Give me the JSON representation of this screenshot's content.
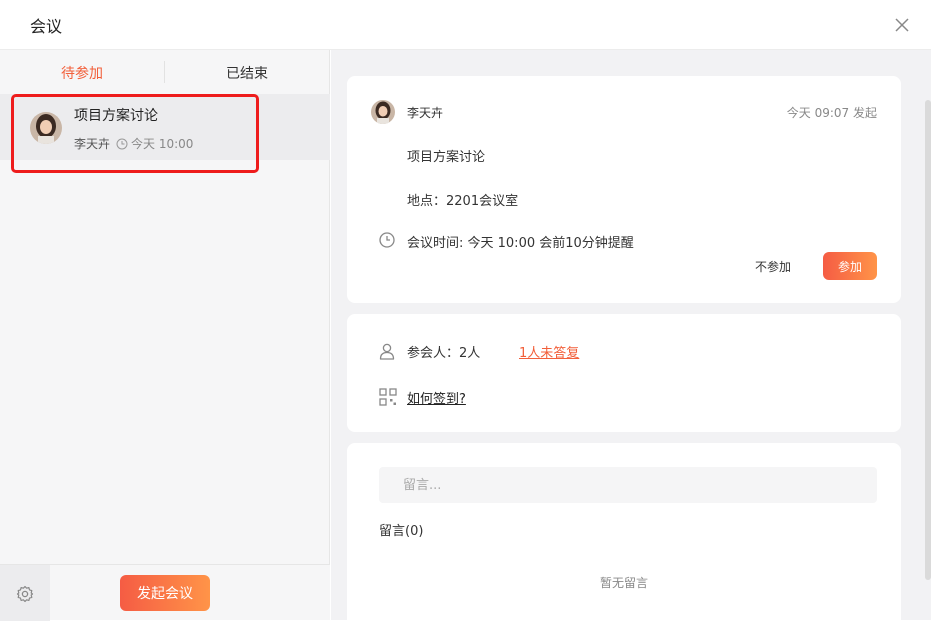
{
  "window": {
    "title": "会议"
  },
  "tabs": {
    "pending": "待参加",
    "ended": "已结束"
  },
  "meeting_list": [
    {
      "title": "项目方案讨论",
      "organizer": "李天卉",
      "time": "今天 10:00"
    }
  ],
  "footer": {
    "start_meeting": "发起会议"
  },
  "detail": {
    "organizer": "李天卉",
    "initiated": "今天 09:07 发起",
    "subject": "项目方案讨论",
    "location": "地点：2201会议室",
    "schedule": "会议时间: 今天 10:00 会前10分钟提醒",
    "decline": "不参加",
    "join": "参加"
  },
  "attendance": {
    "attendees": "参会人：2人",
    "unsigned": "1人未答复",
    "how_to_sign": "如何签到?"
  },
  "comments": {
    "placeholder": "留言...",
    "count_label": "留言(0)",
    "empty": "暂无留言"
  },
  "colors": {
    "accent": "#f25f3a",
    "gradient_start": "#f55c44",
    "gradient_end": "#ff9448",
    "highlight": "#ee1c1c"
  }
}
